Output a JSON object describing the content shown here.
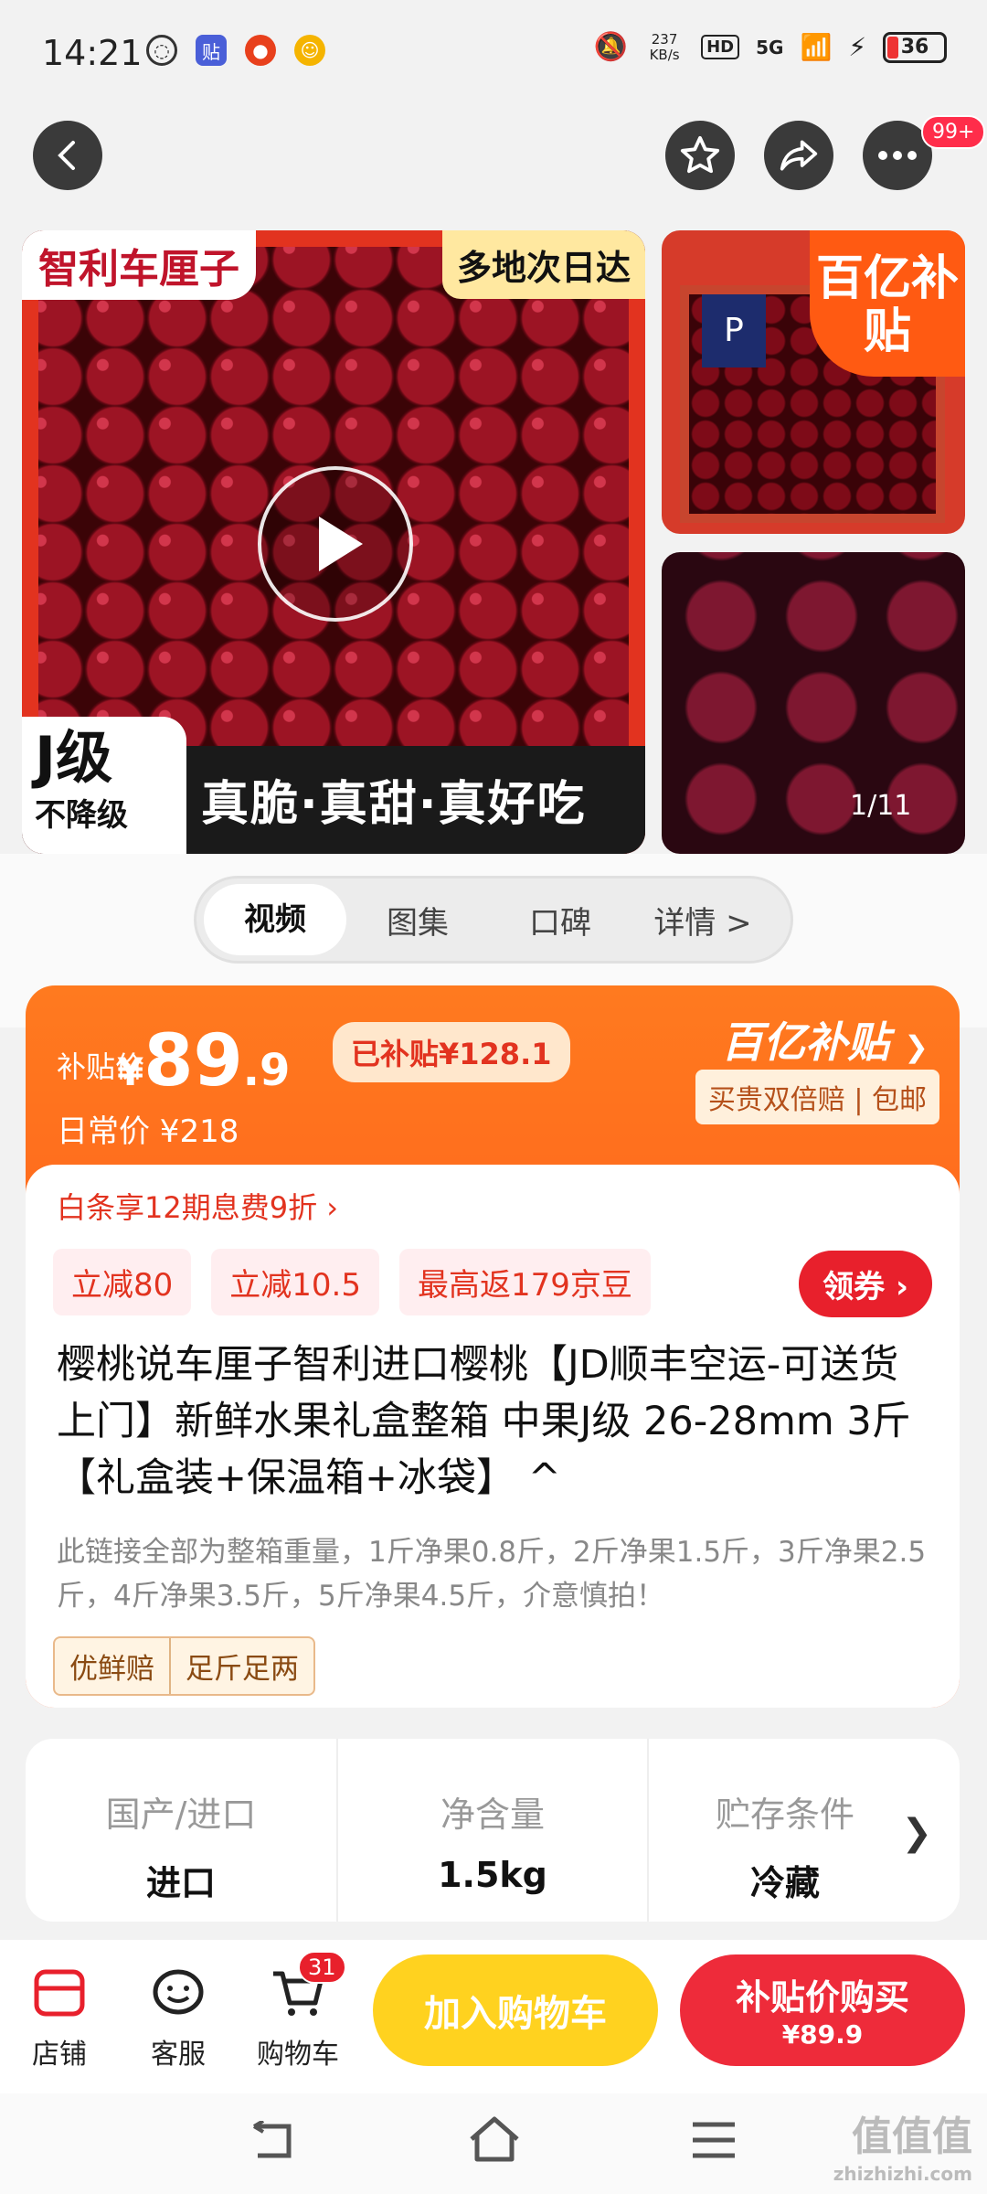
{
  "status": {
    "time": "14:21",
    "net_speed": "237 KB/s",
    "hd": "HD",
    "network": "5G",
    "battery": "36"
  },
  "nav": {
    "badge": "99+"
  },
  "gallery": {
    "main_label_top": "智利车厘子",
    "main_label_topright": "多地次日达",
    "grade_big": "J级",
    "grade_small": "不降级",
    "slogan": "真脆·真甜·真好吃",
    "box_logo": "P",
    "subsidy_badge": "百亿补贴",
    "counter": "1/11"
  },
  "tabs": [
    "视频",
    "图集",
    "口碑",
    "详情 >"
  ],
  "price": {
    "label": "补贴价",
    "yen": "¥",
    "integer": "89",
    "decimal": ".9",
    "subsidized": "已补贴¥128.1",
    "daily": "日常价 ¥218",
    "brand": "百亿补贴",
    "brand_sub": "买贵双倍赔 | 包邮"
  },
  "promo": {
    "baitiao": "白条享12期息费9折 ›",
    "coupons": [
      "立减80",
      "立减10.5",
      "最高返179京豆"
    ],
    "get_coupon": "领券 ›"
  },
  "product": {
    "title": "樱桃说车厘子智利进口樱桃【JD顺丰空运-可送货上门】新鲜水果礼盒整箱 中果J级 26-28mm 3斤【礼盒装+保温箱+冰袋】 ^",
    "note": "此链接全部为整箱重量，1斤净果0.8斤，2斤净果1.5斤，3斤净果2.5斤，4斤净果3.5斤，5斤净果4.5斤，介意慎拍！",
    "tags": [
      "优鲜赔",
      "足斤足两"
    ]
  },
  "specs": [
    {
      "k": "国产/进口",
      "v": "进口"
    },
    {
      "k": "净含量",
      "v": "1.5kg"
    },
    {
      "k": "贮存条件",
      "v": "冷藏"
    }
  ],
  "bottom": {
    "shop": "店铺",
    "service": "客服",
    "cart": "购物车",
    "cart_count": "31",
    "add_cart": "加入购物车",
    "buy_l1": "补贴价购买",
    "buy_l2": "¥89.9"
  },
  "watermark": {
    "main": "值值值",
    "site": "zhizhizhi.com"
  }
}
